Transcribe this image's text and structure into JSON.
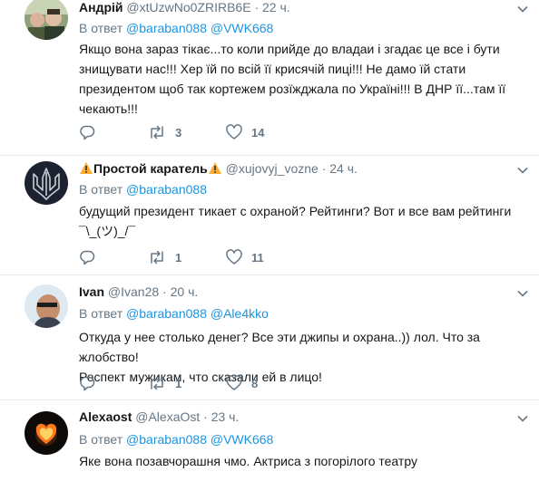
{
  "reply_prefix": "В ответ",
  "tweets": [
    {
      "name": "Андрій",
      "handle": "@xtUzwNo0ZRIRB6E",
      "dot": "·",
      "time": "22 ч.",
      "mentions": [
        "@baraban088",
        "@VWK668"
      ],
      "lines": [
        "Якщо вона зараз тікає...то коли прийде до владаи і згадає це все і бути",
        "знищувати нас!!! Хер їй по всій її крисячій пиці!!! Не дамо їй стати",
        "президентом щоб так кортежем розїжджала по Україні!!! В ДНР її...там її",
        "чекають!!!"
      ],
      "retweets": "3",
      "likes": "14"
    },
    {
      "name": "Простой каратель",
      "handle": "@xujovyj_vozne",
      "dot": "·",
      "time": "24 ч.",
      "mentions": [
        "@baraban088"
      ],
      "lines": [
        "будущий президент тикает с охраной? Рейтинги? Вот и все вам рейтинги",
        "¯\\_(ツ)_/¯"
      ],
      "retweets": "1",
      "likes": "11"
    },
    {
      "name": "Ivan",
      "handle": "@Ivan28",
      "dot": "·",
      "time": "20 ч.",
      "mentions": [
        "@baraban088",
        "@Ale4kko"
      ],
      "lines": [
        "Откуда у нее столько денег? Все эти джипы и охрана..)) лол. Что за жлобство!",
        "Респект мужикам, что сказали ей в лицо!"
      ],
      "retweets": "1",
      "likes": "8"
    },
    {
      "name": "Alexaost",
      "handle": "@AlexaOst",
      "dot": "·",
      "time": "23 ч.",
      "mentions": [
        "@baraban088",
        "@VWK668"
      ],
      "lines": [
        "Яке вона позавчорашня чмо. Актриса з погорілого театру"
      ]
    }
  ],
  "icons": {
    "reply": "reply-icon",
    "retweet": "retweet-icon",
    "like": "heart-icon",
    "more": "chevron-down-icon",
    "warning": "warning-icon"
  },
  "colors": {
    "text": "#14171a",
    "secondary": "#657786",
    "link": "#1b95e0",
    "divider": "#e6ecf0",
    "warning": "#ffac33"
  }
}
